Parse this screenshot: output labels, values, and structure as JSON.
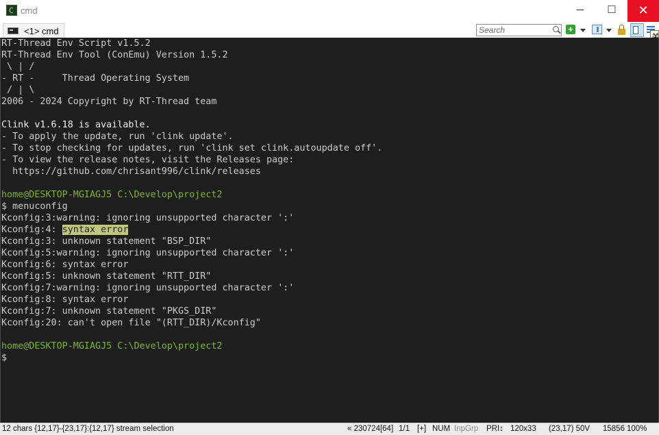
{
  "window": {
    "title": "cmd",
    "minimize": "─",
    "maximize": "☐",
    "close": "✕"
  },
  "tabs": [
    {
      "label": "<1> cmd"
    }
  ],
  "toolbar": {
    "search_placeholder": "Search",
    "new_console": "+",
    "tooltip": "关"
  },
  "console": {
    "lines": [
      {
        "segs": [
          {
            "t": "RT-Thread Env Script v1.5.2",
            "c": ""
          }
        ]
      },
      {
        "segs": [
          {
            "t": "RT-Thread Env Tool (ConEmu) Version 1.5.2",
            "c": ""
          }
        ]
      },
      {
        "segs": [
          {
            "t": " \\ | /",
            "c": ""
          }
        ]
      },
      {
        "segs": [
          {
            "t": "- RT -     Thread Operating System",
            "c": ""
          }
        ]
      },
      {
        "segs": [
          {
            "t": " / | \\",
            "c": ""
          }
        ]
      },
      {
        "segs": [
          {
            "t": "2006 - 2024 Copyright by RT-Thread team",
            "c": ""
          }
        ]
      },
      {
        "segs": [
          {
            "t": "",
            "c": ""
          }
        ]
      },
      {
        "segs": [
          {
            "t": "Clink v1.6.18 is available.",
            "c": "b"
          }
        ]
      },
      {
        "segs": [
          {
            "t": "- To apply the update, run 'clink update'.",
            "c": ""
          }
        ]
      },
      {
        "segs": [
          {
            "t": "- To stop checking for updates, run 'clink set clink.autoupdate off'.",
            "c": ""
          }
        ]
      },
      {
        "segs": [
          {
            "t": "- To view the release notes, visit the Releases page:",
            "c": ""
          }
        ]
      },
      {
        "segs": [
          {
            "t": "  https://github.com/chrisant996/clink/releases",
            "c": ""
          }
        ]
      },
      {
        "segs": [
          {
            "t": "",
            "c": ""
          }
        ]
      },
      {
        "segs": [
          {
            "t": "home@DESKTOP-MGIAGJ5",
            "c": "g"
          },
          {
            "t": " C:\\Develop\\project2",
            "c": "g"
          }
        ]
      },
      {
        "segs": [
          {
            "t": "$",
            "c": "dollar"
          },
          {
            "t": " menuconfig",
            "c": ""
          }
        ]
      },
      {
        "segs": [
          {
            "t": "Kconfig:3:warning: ignoring unsupported character ':'",
            "c": ""
          }
        ]
      },
      {
        "segs": [
          {
            "t": "Kconfig:4: ",
            "c": ""
          },
          {
            "t": "syntax error",
            "c": "hl"
          }
        ]
      },
      {
        "segs": [
          {
            "t": "Kconfig:3: unknown statement \"BSP_DIR\"",
            "c": ""
          }
        ]
      },
      {
        "segs": [
          {
            "t": "Kconfig:5:warning: ignoring unsupported character ':'",
            "c": ""
          }
        ]
      },
      {
        "segs": [
          {
            "t": "Kconfig:6: syntax error",
            "c": ""
          }
        ]
      },
      {
        "segs": [
          {
            "t": "Kconfig:5: unknown statement \"RTT_DIR\"",
            "c": ""
          }
        ]
      },
      {
        "segs": [
          {
            "t": "Kconfig:7:warning: ignoring unsupported character ':'",
            "c": ""
          }
        ]
      },
      {
        "segs": [
          {
            "t": "Kconfig:8: syntax error",
            "c": ""
          }
        ]
      },
      {
        "segs": [
          {
            "t": "Kconfig:7: unknown statement \"PKGS_DIR\"",
            "c": ""
          }
        ]
      },
      {
        "segs": [
          {
            "t": "Kconfig:20: can't open file \"(RTT_DIR)/Kconfig\"",
            "c": ""
          }
        ]
      },
      {
        "segs": [
          {
            "t": "",
            "c": ""
          }
        ]
      },
      {
        "segs": [
          {
            "t": "home@DESKTOP-MGIAGJ5",
            "c": "g"
          },
          {
            "t": " C:\\Develop\\project2",
            "c": "g"
          }
        ]
      },
      {
        "segs": [
          {
            "t": "$",
            "c": "dollar"
          }
        ]
      }
    ]
  },
  "statusbar": {
    "selection": "12 chars {12,17}-{23,17}:{12,17} stream selection",
    "process": "« 230724[64]",
    "pages": "1/1",
    "plus": "[+]",
    "num": "NUM",
    "inpgrp": "InpGrp",
    "pri": "PRI↕",
    "size": "120x33",
    "cursor": "(23,17) 50V",
    "pid": "15856",
    "zoom": "100%"
  }
}
